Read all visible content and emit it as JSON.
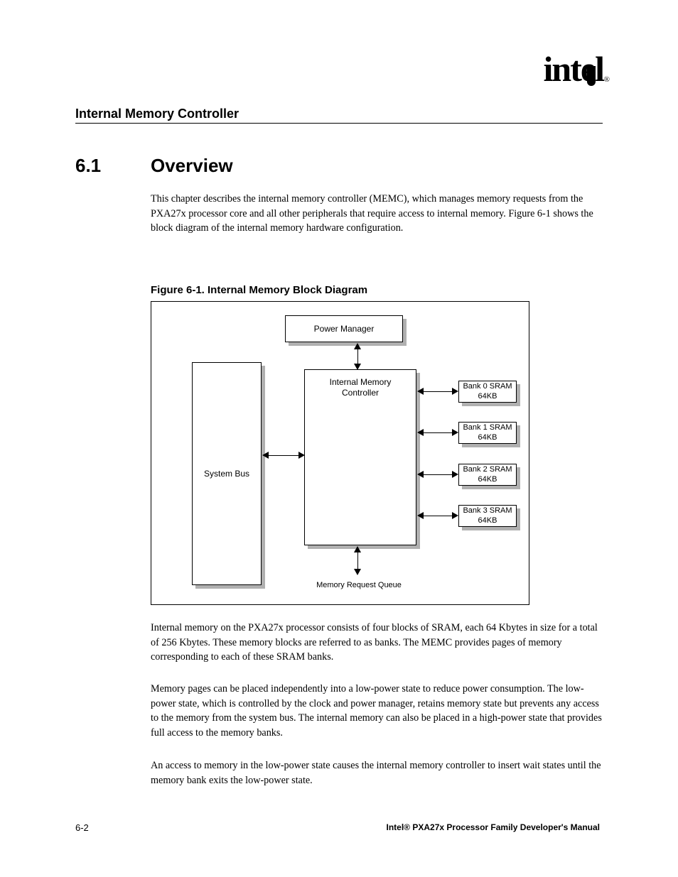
{
  "header": {
    "logo_text": "int",
    "logo_e": "e",
    "logo_l": "l",
    "registered": "®",
    "running_head": "Internal Memory Controller"
  },
  "section": {
    "number": "6.1",
    "title": "Overview"
  },
  "paragraphs": {
    "p1": "This chapter describes the internal memory controller (MEMC), which manages memory requests from the PXA27x processor core and all other peripherals that require access to internal memory. Figure 6-1 shows the block diagram of the internal memory hardware configuration.",
    "p2": "Internal memory on the PXA27x processor consists of four blocks of SRAM, each 64 Kbytes in size for a total of 256 Kbytes. These memory blocks are referred to as banks. The MEMC provides pages of memory corresponding to each of these SRAM banks.",
    "p3": "Memory pages can be placed independently into a low-power state to reduce power consumption. The low-power state, which is controlled by the clock and power manager, retains memory state but prevents any access to the memory from the system bus. The internal memory can also be placed in a high-power state that provides full access to the memory banks.",
    "p4": "An access to memory in the low-power state causes the internal memory controller to insert wait states until the memory bank exits the low-power state."
  },
  "figure": {
    "caption": "Figure 6-1. Internal Memory Block Diagram",
    "boxes": {
      "pm": "Power Manager",
      "sysbus": "System Bus",
      "imc": "Internal Memory Controller",
      "bank0": "Bank 0 SRAM 64KB",
      "bank1": "Bank 1 SRAM 64KB",
      "bank2": "Bank 2 SRAM 64KB",
      "bank3": "Bank 3 SRAM 64KB",
      "queue": "Memory Request Queue"
    }
  },
  "footer": {
    "left": "6-2",
    "right": "Intel® PXA27x Processor Family Developer's Manual"
  }
}
